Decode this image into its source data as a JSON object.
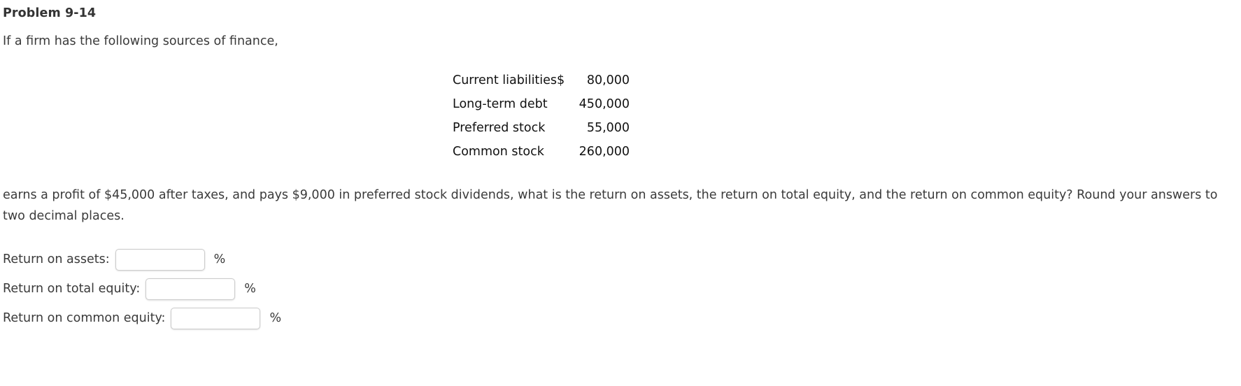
{
  "problem": {
    "title": "Problem 9-14",
    "intro": "If a firm has the following sources of finance,",
    "question": "earns a profit of $45,000 after taxes, and pays $9,000 in preferred stock dividends, what is the return on assets, the return on total equity, and the return on common equity? Round your answers to two decimal places."
  },
  "finance_table": {
    "rows": [
      {
        "label": "Current liabilities",
        "currency": "$",
        "value": "80,000"
      },
      {
        "label": "Long-term debt",
        "currency": "",
        "value": "450,000"
      },
      {
        "label": "Preferred stock",
        "currency": "",
        "value": "55,000"
      },
      {
        "label": "Common stock",
        "currency": "",
        "value": "260,000"
      }
    ]
  },
  "answers": {
    "unit": "%",
    "fields": [
      {
        "label": "Return on assets:",
        "value": "",
        "placeholder": ""
      },
      {
        "label": "Return on total equity:",
        "value": "",
        "placeholder": ""
      },
      {
        "label": "Return on common equity:",
        "value": "",
        "placeholder": ""
      }
    ]
  }
}
